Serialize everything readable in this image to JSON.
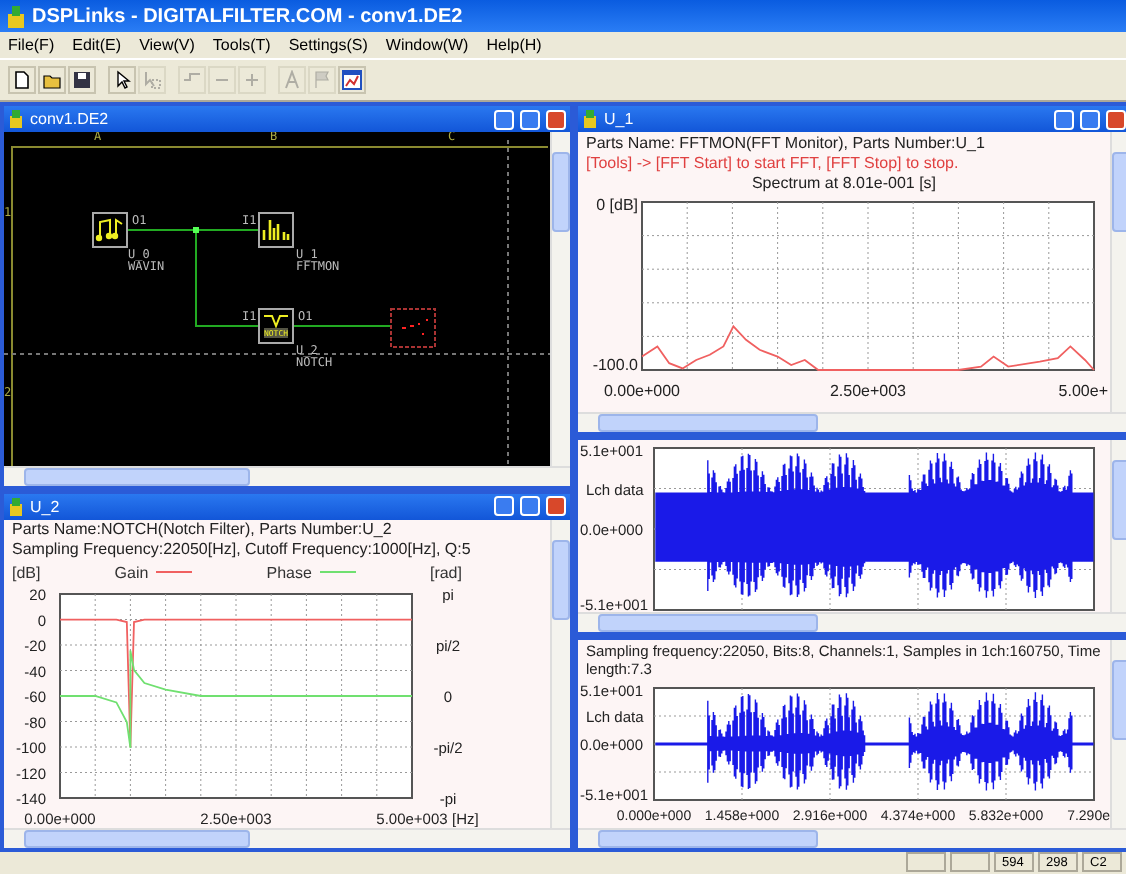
{
  "window": {
    "title": "DSPLinks - DIGITALFILTER.COM - conv1.DE2"
  },
  "menu": [
    "File(F)",
    "Edit(E)",
    "View(V)",
    "Tools(T)",
    "Settings(S)",
    "Window(W)",
    "Help(H)"
  ],
  "toolbar": [
    {
      "kind": "new",
      "disabled": false
    },
    {
      "kind": "open",
      "disabled": false
    },
    {
      "kind": "save",
      "disabled": false
    },
    {
      "kind": "pointer",
      "disabled": false
    },
    {
      "kind": "select",
      "disabled": true
    },
    {
      "kind": "wire",
      "disabled": true
    },
    {
      "kind": "minus",
      "disabled": true
    },
    {
      "kind": "plus",
      "disabled": true
    },
    {
      "kind": "text",
      "disabled": true
    },
    {
      "kind": "flag",
      "disabled": true
    },
    {
      "kind": "monitor",
      "disabled": false
    }
  ],
  "schematic": {
    "title": "conv1.DE2",
    "columns": [
      "A",
      "B",
      "C"
    ],
    "rows": [
      "1",
      "2"
    ],
    "nodes": [
      {
        "kind": "wavin",
        "part": "U_0",
        "name": "WAVIN",
        "ports": [
          "O1"
        ]
      },
      {
        "kind": "fftmon",
        "part": "U_1",
        "name": "FFTMON",
        "ports": [
          "I1"
        ]
      },
      {
        "kind": "notch",
        "part": "U_2",
        "name": "NOTCH",
        "icon_text": "NOTCH",
        "ports": [
          "I1",
          "O1"
        ]
      },
      {
        "kind": "empty"
      }
    ]
  },
  "fft_monitor": {
    "title": "U_1",
    "info": "Parts Name: FFTMON(FFT Monitor), Parts Number:U_1",
    "hint": "[Tools] -> [FFT Start] to start FFT, [FFT Stop] to stop.",
    "chart_data": {
      "type": "line",
      "title": "Spectrum at 8.01e-001 [s]",
      "xlim": [
        0,
        5000
      ],
      "ylim": [
        -100,
        0
      ],
      "x": [
        0,
        170,
        300,
        450,
        600,
        750,
        900,
        1010,
        1150,
        1300,
        1500,
        1650,
        1800,
        1950,
        2500,
        3500,
        3750,
        3890,
        4050,
        4400,
        4600,
        4740,
        4900,
        5000
      ],
      "grid": true,
      "series": [
        {
          "color": "#f06060",
          "values": [
            -92,
            -86,
            -96,
            -99,
            -94,
            -91,
            -86,
            -74,
            -82,
            -88,
            -92,
            -97,
            -94,
            -100,
            -100,
            -100,
            -98,
            -92,
            -98,
            -95,
            -93,
            -86,
            -94,
            -100
          ]
        }
      ],
      "xticks": [
        {
          "value": 0,
          "label": "0.00e+000"
        },
        {
          "value": 2500,
          "label": "2.50e+003"
        }
      ],
      "yticks": [
        {
          "value": 0,
          "label": "0 [dB]"
        },
        {
          "value": -100,
          "label": "-100.0"
        }
      ]
    },
    "cut_tick_label": "5.00e+"
  },
  "filter": {
    "title": "U_2",
    "lines": [
      "Parts Name:NOTCH(Notch Filter), Parts Number:U_2",
      "Sampling Frequency:22050[Hz], Cutoff Frequency:1000[Hz], Q:5"
    ],
    "chart_data": {
      "type": "line",
      "ylabel": "[dB]",
      "y2label": "[rad]",
      "xlabel": "[Hz]",
      "xlim": [
        0,
        5000
      ],
      "ylim": [
        -140,
        20
      ],
      "y2lim": [
        -3.14,
        3.14
      ],
      "grid": true,
      "legend": true,
      "x": [
        0,
        500,
        800,
        950,
        1000,
        1001,
        1050,
        1200,
        1500,
        2000,
        3000,
        5000
      ],
      "series": [
        {
          "name": "Gain",
          "color": "#f06060",
          "values": [
            0,
            0,
            0,
            -2,
            -100,
            -100,
            -2,
            0,
            0,
            0,
            0,
            0
          ]
        },
        {
          "name": "Phase",
          "color": "#70e070",
          "axis": "y2",
          "values": [
            0,
            0,
            -0.2,
            -0.8,
            -1.6,
            1.4,
            0.8,
            0.4,
            0.2,
            0,
            0,
            0
          ]
        }
      ],
      "xticks": [
        {
          "value": 0,
          "label": "0.00e+000"
        },
        {
          "value": 2500,
          "label": "2.50e+003"
        },
        {
          "value": 5000,
          "label": "5.00e+003"
        }
      ],
      "yticks": [
        20,
        0,
        -20,
        -40,
        -60,
        -80,
        -100,
        -120,
        -140
      ],
      "y2ticks": [
        {
          "value": 3.14,
          "label": "pi"
        },
        {
          "value": 1.57,
          "label": "pi/2"
        },
        {
          "value": 0,
          "label": "0"
        },
        {
          "value": -1.57,
          "label": "-pi/2"
        },
        {
          "value": -3.14,
          "label": "-pi"
        }
      ]
    }
  },
  "input_wave": {
    "channel": "Lch data",
    "yticks": [
      "5.1e+001",
      "0.0e+000",
      "-5.1e+001"
    ]
  },
  "output_wave": {
    "info": "Sampling frequency:22050, Bits:8, Channels:1, Samples in 1ch:160750, Time length:7.3",
    "channel": "Lch data",
    "yticks": [
      "5.1e+001",
      "0.0e+000",
      "-5.1e+001"
    ],
    "xticks": [
      "0.000e+000",
      "1.458e+000",
      "2.916e+000",
      "4.374e+000",
      "5.832e+000",
      "7.290e"
    ]
  },
  "status_bar": [
    "594",
    "298",
    "C2"
  ]
}
